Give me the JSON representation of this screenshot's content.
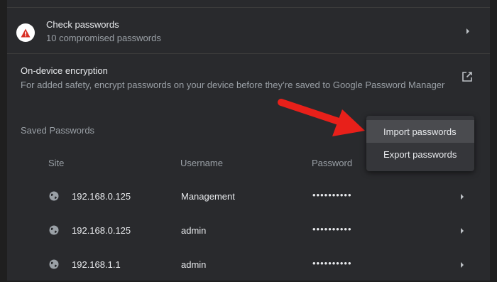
{
  "check_passwords": {
    "title": "Check passwords",
    "subtitle": "10 compromised passwords",
    "icon": "warning-icon"
  },
  "encryption": {
    "title": "On-device encryption",
    "description": "For added safety, encrypt passwords on your device before they’re saved to Google Password Manager",
    "icon": "open-in-new-icon"
  },
  "saved_passwords": {
    "title": "Saved Passwords",
    "columns": {
      "site": "Site",
      "username": "Username",
      "password": "Password"
    },
    "rows": [
      {
        "site": "192.168.0.125",
        "username": "Management",
        "password": "••••••••••"
      },
      {
        "site": "192.168.0.125",
        "username": "admin",
        "password": "••••••••••"
      },
      {
        "site": "192.168.1.1",
        "username": "admin",
        "password": "••••••••••"
      }
    ]
  },
  "menu": {
    "items": [
      {
        "label": "Import passwords",
        "highlighted": true
      },
      {
        "label": "Export passwords",
        "highlighted": false
      }
    ]
  },
  "colors": {
    "background": "#292a2d",
    "warning": "#d93025",
    "arrow": "#e8201a",
    "menu_bg": "#35363a",
    "menu_hover": "#4a4b4f"
  }
}
